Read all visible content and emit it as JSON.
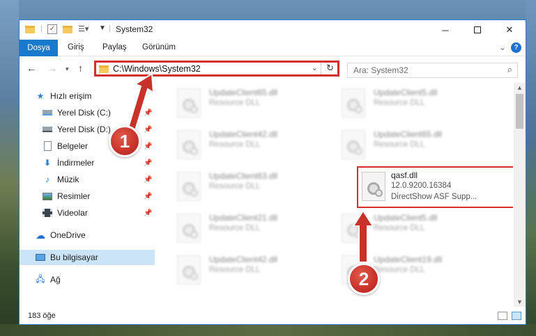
{
  "window": {
    "title": "System32",
    "minimize_icon": "minimize-icon",
    "maximize_icon": "maximize-icon",
    "close_icon": "close-icon"
  },
  "ribbon": {
    "tabs": [
      "Dosya",
      "Giriş",
      "Paylaş",
      "Görünüm"
    ],
    "file_tab_color": "#1979ca"
  },
  "address": {
    "path": "C:\\Windows\\System32"
  },
  "search": {
    "placeholder": "Ara: System32"
  },
  "sidebar": {
    "quick_access": "Hızlı erişim",
    "items": [
      {
        "label": "Yerel Disk (C:)",
        "icon": "drive-icon",
        "pinned": true
      },
      {
        "label": "Yerel Disk (D:)",
        "icon": "drive-icon",
        "pinned": true
      },
      {
        "label": "Belgeler",
        "icon": "documents-icon",
        "pinned": true
      },
      {
        "label": "İndirmeler",
        "icon": "downloads-icon",
        "pinned": true
      },
      {
        "label": "Müzik",
        "icon": "music-icon",
        "pinned": true
      },
      {
        "label": "Resimler",
        "icon": "pictures-icon",
        "pinned": true
      },
      {
        "label": "Videolar",
        "icon": "videos-icon",
        "pinned": true
      }
    ],
    "onedrive": "OneDrive",
    "this_pc": "Bu bilgisayar",
    "network": "Ağ"
  },
  "files": [
    {
      "name": "UpdateClient65.dll",
      "desc": "Resource DLL"
    },
    {
      "name": "UpdateClient5.dll",
      "desc": "Resource DLL"
    },
    {
      "name": "UpdateClient42.dll",
      "desc": "Resource DLL"
    },
    {
      "name": "UpdateClient65.dll",
      "desc": "Resource DLL"
    },
    {
      "name": "UpdateClient63.dll",
      "desc": "Resource DLL"
    },
    {
      "name": "qasf.dll",
      "version": "12.0.9200.16384",
      "desc": "DirectShow ASF Supp..."
    },
    {
      "name": "UpdateClient21.dll",
      "desc": "Resource DLL"
    },
    {
      "name": "UpdateClient5.dll",
      "desc": "Resource DLL"
    },
    {
      "name": "UpdateClient42.dll",
      "desc": "Resource DLL"
    },
    {
      "name": "UpdateClient19.dll",
      "desc": "Resource DLL"
    }
  ],
  "status": {
    "count": "183 öğe"
  },
  "annotations": {
    "badge1": "1",
    "badge2": "2",
    "highlight_color": "#d32f2f"
  }
}
